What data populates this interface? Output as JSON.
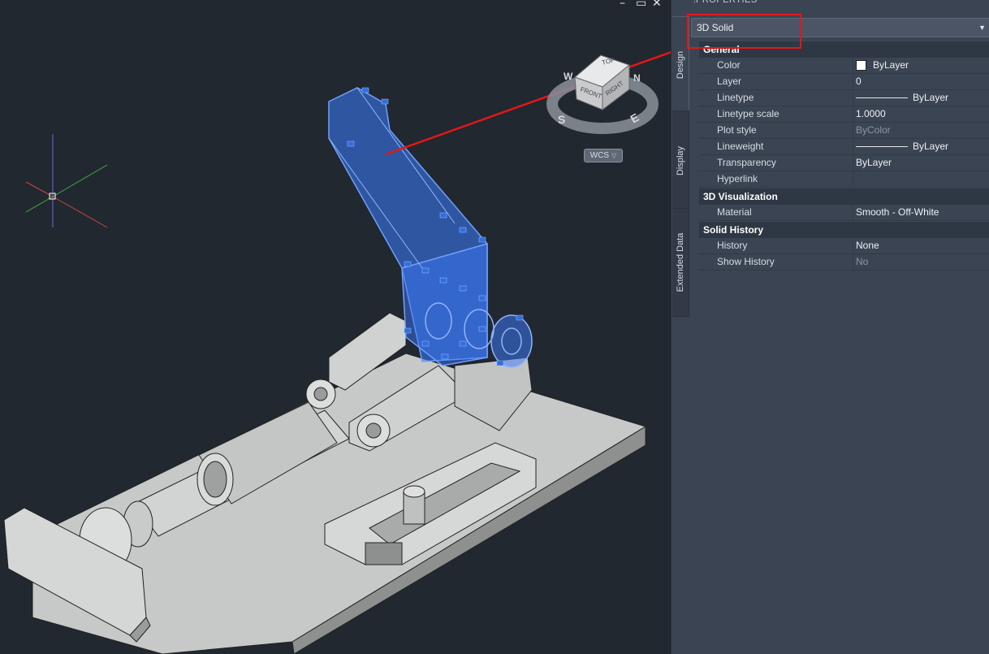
{
  "window_controls": {
    "minimize": "–",
    "restore": "▭",
    "close": "✕"
  },
  "viewcube": {
    "top": "TOP",
    "front": "FRONT",
    "right": "RIGHT",
    "compass_s": "S",
    "compass_e": "E",
    "compass_w": "W",
    "compass_n": "N"
  },
  "wcs": {
    "label": "WCS",
    "caret": "▽"
  },
  "palette": {
    "title": "PROPERTIES",
    "grip": "⁞",
    "tabs": [
      "Design",
      "Display",
      "Extended Data"
    ],
    "selector": {
      "value": "3D Solid",
      "arrow": "▼"
    },
    "categories": [
      {
        "name": "General",
        "rows": [
          {
            "label": "Color",
            "value": "ByLayer",
            "swatch": "#ffffff"
          },
          {
            "label": "Layer",
            "value": "0"
          },
          {
            "label": "Linetype",
            "value": "ByLayer"
          },
          {
            "label": "Linetype scale",
            "value": "1.0000"
          },
          {
            "label": "Plot style",
            "value": "ByColor"
          },
          {
            "label": "Lineweight",
            "value": "ByLayer"
          },
          {
            "label": "Transparency",
            "value": "ByLayer"
          },
          {
            "label": "Hyperlink",
            "value": ""
          }
        ]
      },
      {
        "name": "3D Visualization",
        "rows": [
          {
            "label": "Material",
            "value": "Smooth - Off-White"
          }
        ]
      },
      {
        "name": "Solid History",
        "rows": [
          {
            "label": "History",
            "value": "None"
          },
          {
            "label": "Show History",
            "value": "No"
          }
        ]
      }
    ]
  },
  "colors": {
    "selection": "#3d7bff",
    "annotation": "#e51616",
    "background": "#212830"
  }
}
